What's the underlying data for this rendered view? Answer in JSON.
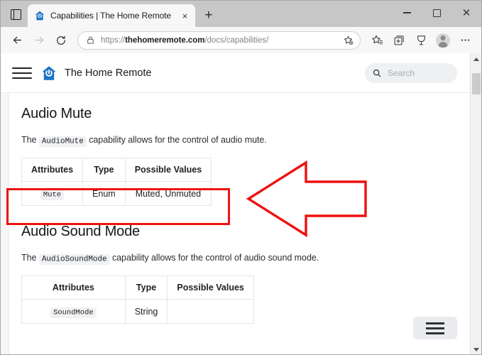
{
  "browser": {
    "tab_actions_label": "Tab actions",
    "tab": {
      "title": "Capabilities | The Home Remote",
      "favicon": "home-power-icon",
      "close_label": "×"
    },
    "new_tab_label": "+",
    "window_controls": {
      "minimize": "—",
      "maximize": "☐",
      "close": "✕"
    },
    "toolbar": {
      "back_label": "Back",
      "forward_label": "Forward",
      "refresh_label": "Refresh",
      "lock_icon": "lock-icon",
      "url_scheme": "https://",
      "url_domain": "thehomeremote.com",
      "url_path": "/docs/capabilities/",
      "favorite_label": "Add this page to favorites",
      "favorites_label": "Favorites",
      "collections_label": "Collections",
      "browser_essentials_label": "Browser essentials",
      "profile_label": "Profile",
      "settings_label": "Settings and more"
    }
  },
  "site": {
    "nav_toggle_label": "Toggle navigation",
    "brand_name": "The Home Remote",
    "brand_logo": "home-power-icon",
    "search": {
      "placeholder": "Search",
      "icon": "search-icon"
    },
    "toc_button_label": "Table of contents"
  },
  "content": {
    "sections": [
      {
        "heading": "Audio Mute",
        "desc_prefix": "The ",
        "desc_code": "AudioMute",
        "desc_suffix": " capability allows for the control of audio mute.",
        "table": {
          "headers": [
            "Attributes",
            "Type",
            "Possible Values"
          ],
          "rows": [
            {
              "attribute": "Mute",
              "type": "Enum",
              "values": "Muted, Unmuted"
            }
          ]
        }
      },
      {
        "heading": "Audio Sound Mode",
        "desc_prefix": "The ",
        "desc_code": "AudioSoundMode",
        "desc_suffix": " capability allows for the control of audio sound mode.",
        "table": {
          "headers": [
            "Attributes",
            "Type",
            "Possible Values"
          ],
          "rows": [
            {
              "attribute": "SoundMode",
              "type": "String",
              "values": ""
            }
          ]
        }
      }
    ]
  },
  "annotations": {
    "highlight_color": "#ee1111",
    "arrow_color": "#ee1111",
    "arrow_direction": "left",
    "highlight_target": "audio-mute-table-row"
  },
  "scrollbar": {
    "up_label": "Scroll up",
    "down_label": "Scroll down",
    "thumb_label": "Scroll thumb"
  }
}
